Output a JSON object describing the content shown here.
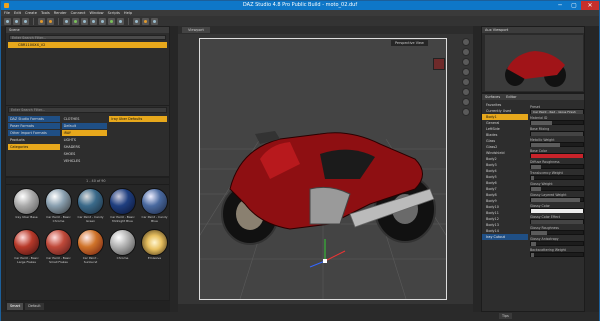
{
  "window": {
    "title": "DAZ Studio 4.8 Pro Public Build - moto_02.duf"
  },
  "menus": [
    "File",
    "Edit",
    "Create",
    "Tools",
    "Render",
    "Connect",
    "Window",
    "Scripts",
    "Help"
  ],
  "scene": {
    "header": "Scene",
    "search_placeholder": "Enter Search Filter...",
    "node": "CBR1100XX_V2"
  },
  "content": {
    "search_placeholder": "Enter Search Filter...",
    "col1": [
      "DAZ Studio Formats",
      "Poser Formats",
      "Other Import Formats",
      "Products",
      "Categories"
    ],
    "col2": [
      "CLOTHES",
      "Default",
      "iRAY",
      "LIGHTS",
      "SHADERS",
      "SHOES",
      "VEHICLES"
    ],
    "col3": [
      "Iray Uber Defaults"
    ],
    "count": "1 - 40 of 90"
  },
  "thumbs": [
    "Iray Uber Base",
    "Car Paint - Basic Chrome",
    "Car Paint - Candy Green",
    "Car Paint - Basic Midnight Blue",
    "Car Paint - Candy Blue",
    "Car Paint - Basic Large Flakes",
    "Car Paint - Basic Small Flakes",
    "Car Paint - Sunburst",
    "Chrome",
    "Emissive"
  ],
  "bottom_tabs": [
    "Smart",
    "Default"
  ],
  "viewport": {
    "tab": "Viewport",
    "perspective": "Perspective View"
  },
  "aux": {
    "tab": "Aux Viewport"
  },
  "shaders": {
    "tabs": [
      "Surfaces",
      "Editor"
    ],
    "list": [
      "Favorites",
      "Currently Used",
      "Body1",
      "General",
      "LeftSide",
      "Blades",
      "Glass",
      "Glass2",
      "Windshield",
      "Body2",
      "Body3",
      "Body4",
      "Body5",
      "Body6",
      "Body7",
      "Body8",
      "Body9",
      "Body10",
      "Body11",
      "Body12",
      "Body13",
      "Body14",
      "Body15"
    ],
    "props": [
      {
        "label": "Preset",
        "val": "Car Paint - Red - Gloss Finish",
        "fill": 1,
        "color": "#444"
      },
      {
        "label": "Material ID",
        "val": "",
        "fill": 0.4,
        "color": "#5b5b5b"
      },
      {
        "label": "Base Mixing",
        "val": "",
        "fill": 1,
        "color": "#444"
      },
      {
        "label": "Metallic Weight",
        "val": "",
        "fill": 0.55,
        "color": "#5b5b5b"
      },
      {
        "label": "Base Color",
        "val": "",
        "fill": 1,
        "color": "#c8232a"
      },
      {
        "label": "Diffuse Roughness",
        "val": "",
        "fill": 0.2,
        "color": "#5b5b5b"
      },
      {
        "label": "Translucency Weight",
        "val": "",
        "fill": 0.05,
        "color": "#5b5b5b"
      },
      {
        "label": "Glossy Weight",
        "val": "",
        "fill": 0.2,
        "color": "#5b5b5b"
      },
      {
        "label": "Glossy Layered Weight",
        "val": "",
        "fill": 0.95,
        "color": "#5b5b5b"
      },
      {
        "label": "Glossy Color",
        "val": "",
        "fill": 1,
        "color": "#eee"
      },
      {
        "label": "Glossy Color Effect",
        "val": "",
        "fill": 1,
        "color": "#444"
      },
      {
        "label": "Glossy Roughness",
        "val": "",
        "fill": 0.3,
        "color": "#5b5b5b"
      },
      {
        "label": "Glossy Anisotropy",
        "val": "",
        "fill": 0.1,
        "color": "#5b5b5b"
      },
      {
        "label": "Backscattering Weight",
        "val": "",
        "fill": 0.05,
        "color": "#5b5b5b"
      }
    ],
    "flake": "Iray Cutout"
  },
  "tips": "Tips"
}
